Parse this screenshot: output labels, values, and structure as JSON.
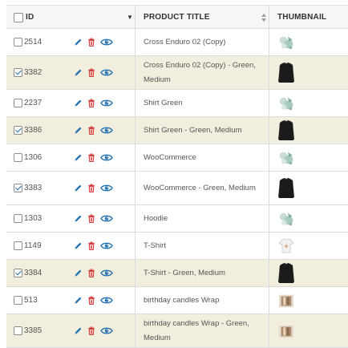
{
  "header": {
    "id_label": "ID",
    "title_label": "PRODUCT TITLE",
    "thumbnail_label": "THUMBNAIL",
    "sort_indicator": "▼"
  },
  "rows": [
    {
      "id": "2514",
      "title": "Cross Enduro 02 (Copy)",
      "checked": false,
      "highlight": false,
      "thumb": "logo"
    },
    {
      "id": "3382",
      "title": "Cross Enduro 02 (Copy) - Green, Medium",
      "checked": true,
      "highlight": true,
      "thumb": "shirt-dark"
    },
    {
      "id": "2237",
      "title": "Shirt Green",
      "checked": false,
      "highlight": false,
      "thumb": "logo"
    },
    {
      "id": "3386",
      "title": "Shirt Green - Green, Medium",
      "checked": true,
      "highlight": true,
      "thumb": "shirt-dark"
    },
    {
      "id": "1306",
      "title": "WooCommerce",
      "checked": false,
      "highlight": false,
      "thumb": "logo"
    },
    {
      "id": "3383",
      "title": "WooCommerce - Green, Medium",
      "checked": true,
      "highlight": false,
      "thumb": "shirt-dark"
    },
    {
      "id": "1303",
      "title": "Hoodie",
      "checked": false,
      "highlight": false,
      "thumb": "logo"
    },
    {
      "id": "1149",
      "title": "T-Shirt",
      "checked": false,
      "highlight": false,
      "thumb": "tshirt-light"
    },
    {
      "id": "3384",
      "title": "T-Shirt - Green, Medium",
      "checked": true,
      "highlight": true,
      "thumb": "shirt-dark"
    },
    {
      "id": "513",
      "title": "birthday candles Wrap",
      "checked": false,
      "highlight": false,
      "thumb": "wrap"
    },
    {
      "id": "3385",
      "title": "birthday candles Wrap - Green, Medium",
      "checked": false,
      "highlight": true,
      "thumb": "wrap"
    }
  ],
  "colors": {
    "accent": "#2271b1",
    "delete": "#d63638",
    "highlight": "#f2eedd"
  },
  "icons": {
    "edit": "pencil-icon",
    "delete": "trash-icon",
    "view": "eye-icon"
  }
}
